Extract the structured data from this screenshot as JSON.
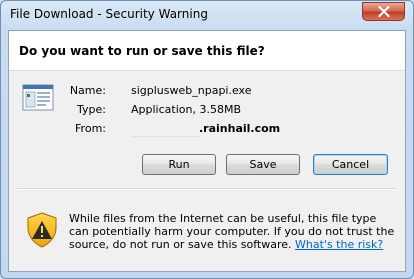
{
  "window": {
    "title": "File Download - Security Warning",
    "close_icon": "close-icon"
  },
  "header": {
    "question": "Do you want to run or save this file?"
  },
  "file": {
    "icon": "application-file-icon",
    "name_label": "Name:",
    "name_value": "sigplusweb_npapi.exe",
    "type_label": "Type:",
    "type_value": "Application, 3.58MB",
    "from_label": "From:",
    "from_value": ".rainhail.com"
  },
  "buttons": {
    "run": "Run",
    "save": "Save",
    "cancel": "Cancel"
  },
  "warning": {
    "icon": "security-shield-warning-icon",
    "text": "While files from the Internet can be useful, this file type can potentially harm your computer. If you do not trust the source, do not run or save this software.",
    "link": "What's the risk?"
  },
  "colors": {
    "accent": "#3c7fb1",
    "link": "#0066cc",
    "close_button": "#c0391f"
  }
}
